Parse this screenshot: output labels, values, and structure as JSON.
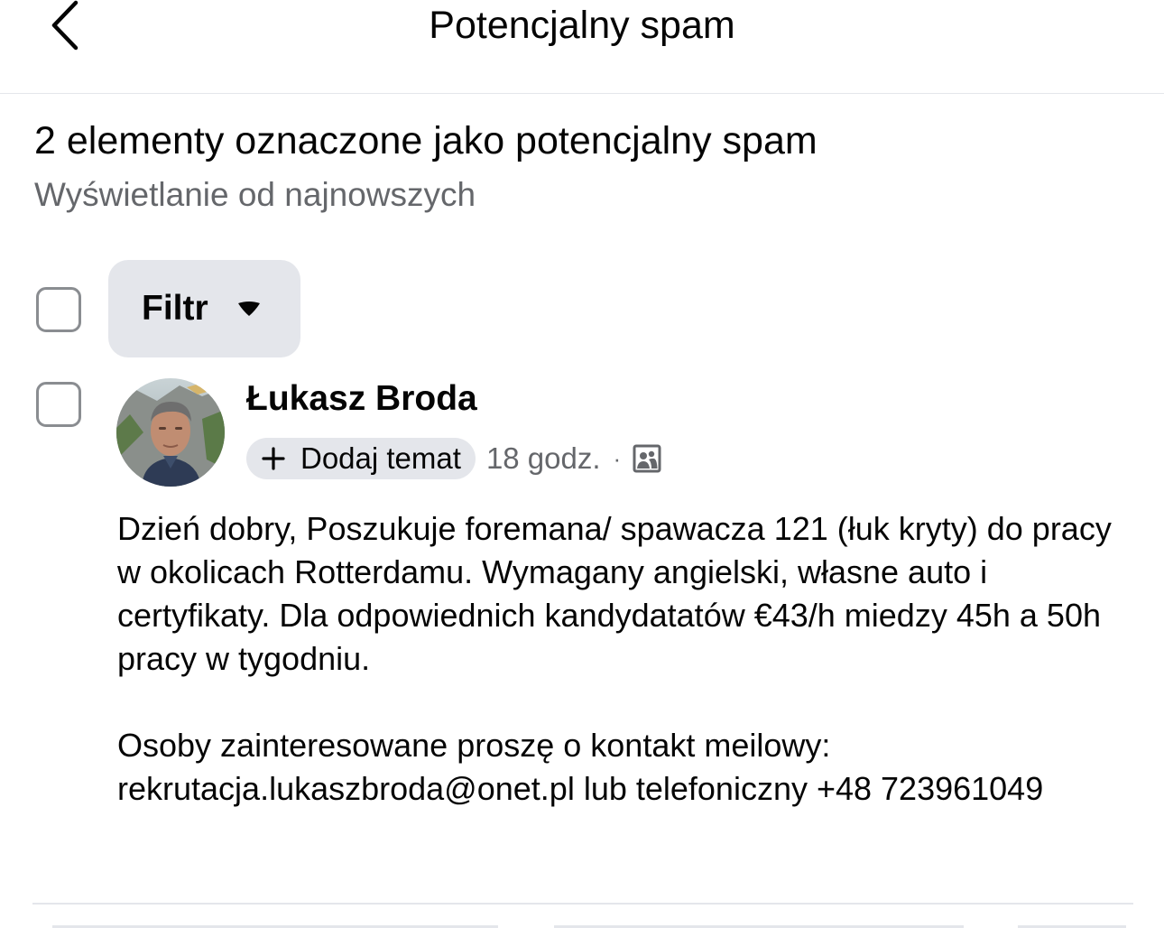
{
  "header": {
    "title": "Potencjalny spam",
    "back_icon": "chevron-left-icon"
  },
  "summary": {
    "title": "2 elementy oznaczone jako potencjalny spam",
    "sort_text": "Wyświetlanie od najnowszych"
  },
  "toolbar": {
    "filter_label": "Filtr",
    "filter_icon": "caret-down-icon"
  },
  "post": {
    "author": "Łukasz Broda",
    "add_topic_label": "Dodaj temat",
    "time": "18 godz.",
    "separator": "·",
    "audience_icon": "group-photo-icon",
    "body": {
      "paragraph1": "Dzień dobry, Poszukuje foremana/ spawacza 121 (łuk kryty) do pracy w okolicach Rotterdamu. Wymagany angielski, własne auto i certyfikaty. Dla odpowiednich kandydatatów €43/h miedzy 45h a 50h pracy w tygodniu.",
      "paragraph2": "Osoby zainteresowane proszę o kontakt meilowy: rekrutacja.lukaszbroda@onet.pl lub telefoniczny +48 723961049"
    }
  },
  "colors": {
    "text_primary": "#050505",
    "text_secondary": "#65676b",
    "chip_background": "#e4e6eb",
    "checkbox_border": "#8a8d91"
  }
}
